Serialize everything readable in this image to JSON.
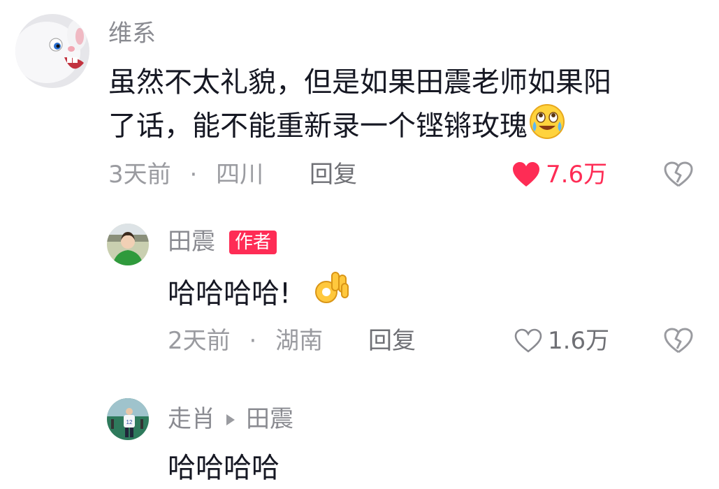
{
  "comment": {
    "author": "维系",
    "text_line1": "虽然不太礼貌，但是如果田震老师如果阳",
    "text_line2": "了话，能不能重新录一个铿锵玫瑰",
    "emoji": "tearful-smile-emoji",
    "time": "3天前",
    "location": "四川",
    "reply_label": "回复",
    "likes": "7.6万",
    "liked": true,
    "accent_color": "#fe2c55"
  },
  "reply1": {
    "author": "田震",
    "badge": "作者",
    "text": "哈哈哈哈!",
    "emoji": "ok-hand-emoji",
    "time": "2天前",
    "location": "湖南",
    "reply_label": "回复",
    "likes": "1.6万",
    "liked": false
  },
  "reply2": {
    "author": "走肖",
    "reply_to": "田震",
    "text": "哈哈哈哈"
  },
  "separator": "·"
}
